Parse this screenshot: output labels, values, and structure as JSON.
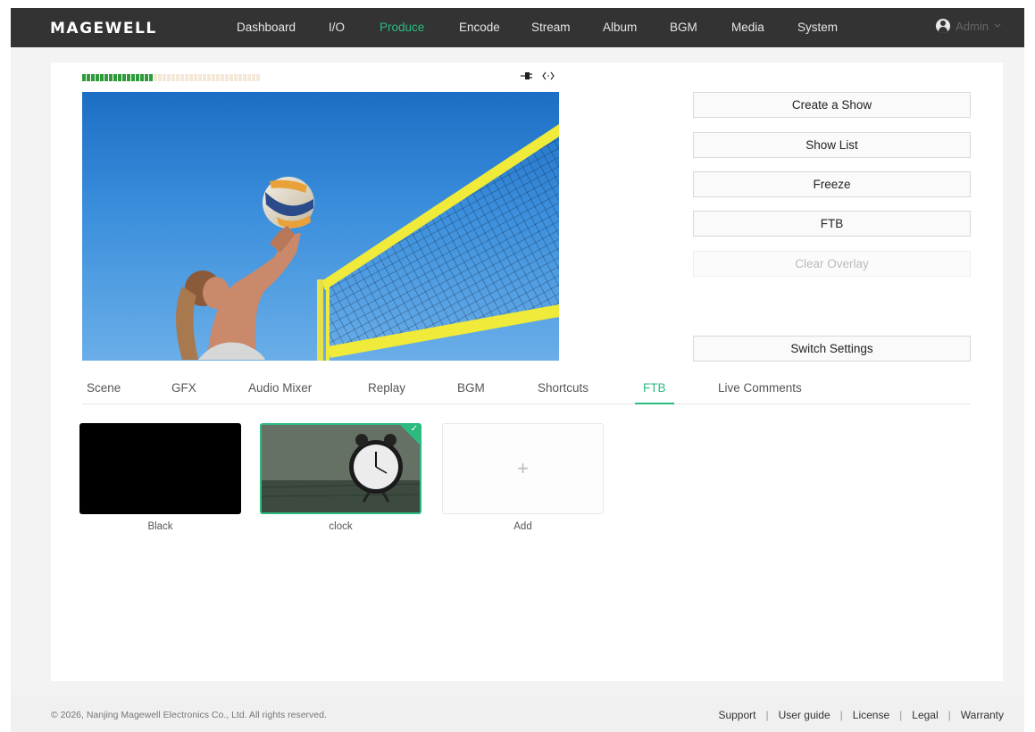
{
  "brand": {
    "logo": "MAGEWELL"
  },
  "nav": {
    "items": [
      {
        "label": "Dashboard",
        "active": false
      },
      {
        "label": "I/O",
        "active": false
      },
      {
        "label": "Produce",
        "active": true
      },
      {
        "label": "Encode",
        "active": false
      },
      {
        "label": "Stream",
        "active": false
      },
      {
        "label": "Album",
        "active": false
      },
      {
        "label": "BGM",
        "active": false
      },
      {
        "label": "Media",
        "active": false
      },
      {
        "label": "System",
        "active": false
      }
    ],
    "user": {
      "name": "Admin",
      "icon": "user-avatar-icon",
      "caret": "chevron-down-icon"
    }
  },
  "preview": {
    "audio_meter": {
      "level": 0.4,
      "segments": 40
    },
    "status_icons": [
      "plug-icon",
      "code-icon"
    ]
  },
  "actions": {
    "create_show": "Create a Show",
    "show_list": "Show List",
    "freeze": "Freeze",
    "ftb": "FTB",
    "clear_overlay": "Clear Overlay",
    "switch_settings": "Switch Settings"
  },
  "tabs": [
    {
      "label": "Scene",
      "active": false
    },
    {
      "label": "GFX",
      "active": false
    },
    {
      "label": "Audio Mixer",
      "active": false
    },
    {
      "label": "Replay",
      "active": false
    },
    {
      "label": "BGM",
      "active": false
    },
    {
      "label": "Shortcuts",
      "active": false
    },
    {
      "label": "FTB",
      "active": true
    },
    {
      "label": "Live Comments",
      "active": false
    }
  ],
  "ftb_items": [
    {
      "label": "Black",
      "selected": false
    },
    {
      "label": "clock",
      "selected": true
    },
    {
      "label": "Add",
      "selected": false,
      "icon": "plus-icon"
    }
  ],
  "footer": {
    "copyright": "© 2026, Nanjing Magewell Electronics Co., Ltd. All rights reserved.",
    "links": [
      "Support",
      "User guide",
      "License",
      "Legal",
      "Warranty"
    ]
  },
  "colors": {
    "accent": "#2bbb7f",
    "nav_bg": "#333333",
    "meter_on": "#2e9a3a",
    "meter_off": "#f4e9d8"
  }
}
